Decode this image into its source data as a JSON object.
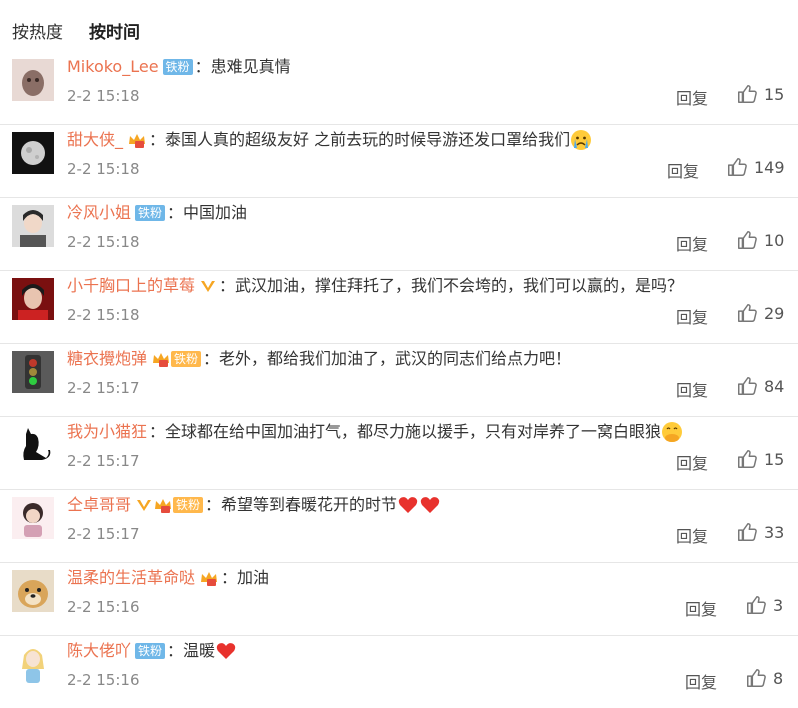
{
  "tabs": {
    "hot": "按热度",
    "time": "按时间"
  },
  "reply_label": "回复",
  "comments": [
    {
      "name": "Mikoko_Lee",
      "badge": "铁粉",
      "text": "患难见真情",
      "time": "2-2 15:18",
      "likes": "15"
    },
    {
      "name": "甜大侠_",
      "badge": "",
      "text": "泰国人真的超级友好 之前去玩的时候导游还发口罩给我们",
      "time": "2-2 15:18",
      "likes": "149"
    },
    {
      "name": "冷风小姐",
      "badge": "铁粉",
      "text": "中国加油",
      "time": "2-2 15:18",
      "likes": "10"
    },
    {
      "name": "小千胸口上的草莓",
      "badge": "",
      "text": "武汉加油，撑住拜托了，我们不会垮的，我们可以赢的，是吗？",
      "time": "2-2 15:18",
      "likes": "29"
    },
    {
      "name": "糖衣攪炮弹",
      "badge": "铁粉",
      "text": "老外，都给我们加油了，武汉的同志们给点力吧！",
      "time": "2-2 15:17",
      "likes": "84"
    },
    {
      "name": "我为小猫狂",
      "badge": "",
      "text": "全球都在给中国加油打气，都尽力施以援手，只有对岸养了一窝白眼狼",
      "time": "2-2 15:17",
      "likes": "15"
    },
    {
      "name": "仝卓哥哥",
      "badge": "铁粉",
      "text": "希望等到春暖花开的时节",
      "time": "2-2 15:17",
      "likes": "33"
    },
    {
      "name": "温柔的生活革命哒",
      "badge": "",
      "text": "加油",
      "time": "2-2 15:16",
      "likes": "3"
    },
    {
      "name": "陈大佬吖",
      "badge": "铁粉",
      "text": "温暖",
      "time": "2-2 15:16",
      "likes": "8"
    }
  ]
}
